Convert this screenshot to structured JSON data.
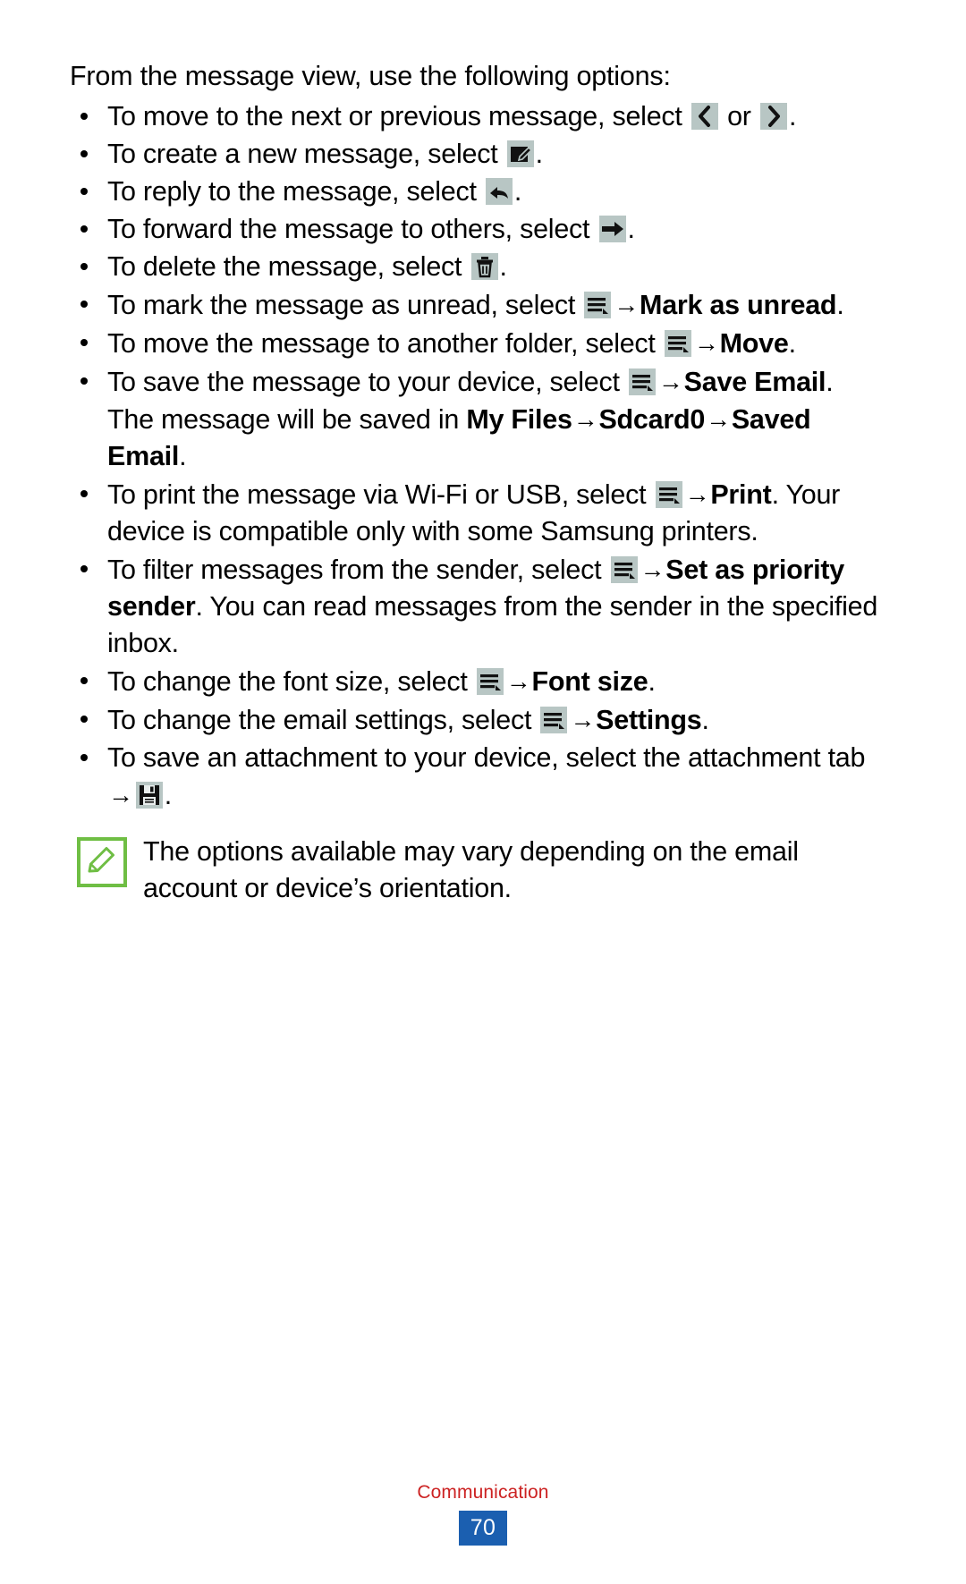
{
  "document": {
    "intro": "From the message view, use the following options:",
    "bullets": [
      {
        "id": "move-next-previous",
        "parts": [
          {
            "t": "text",
            "v": "To move to the next or previous message, select "
          },
          {
            "t": "icon",
            "v": "chevron-left-icon"
          },
          {
            "t": "text",
            "v": " or "
          },
          {
            "t": "icon",
            "v": "chevron-right-icon"
          },
          {
            "t": "text",
            "v": "."
          }
        ]
      },
      {
        "id": "create-new-message",
        "parts": [
          {
            "t": "text",
            "v": "To create a new message, select "
          },
          {
            "t": "icon",
            "v": "compose-icon"
          },
          {
            "t": "text",
            "v": "."
          }
        ]
      },
      {
        "id": "reply-message",
        "parts": [
          {
            "t": "text",
            "v": "To reply to the message, select "
          },
          {
            "t": "icon",
            "v": "reply-arrow-icon"
          },
          {
            "t": "text",
            "v": "."
          }
        ]
      },
      {
        "id": "forward-message",
        "parts": [
          {
            "t": "text",
            "v": "To forward the message to others, select "
          },
          {
            "t": "icon",
            "v": "forward-arrow-icon"
          },
          {
            "t": "text",
            "v": "."
          }
        ]
      },
      {
        "id": "delete-message",
        "parts": [
          {
            "t": "text",
            "v": "To delete the message, select "
          },
          {
            "t": "icon",
            "v": "trash-icon"
          },
          {
            "t": "text",
            "v": "."
          }
        ]
      },
      {
        "id": "mark-as-unread",
        "parts": [
          {
            "t": "text",
            "v": "To mark the message as unread, select "
          },
          {
            "t": "icon",
            "v": "menu-icon"
          },
          {
            "t": "arrow",
            "v": "→"
          },
          {
            "t": "bold",
            "v": "Mark as unread"
          },
          {
            "t": "text",
            "v": "."
          }
        ]
      },
      {
        "id": "move-to-folder",
        "parts": [
          {
            "t": "text",
            "v": "To move the message to another folder, select "
          },
          {
            "t": "icon",
            "v": "menu-icon"
          },
          {
            "t": "arrow",
            "v": "→"
          },
          {
            "t": "bold",
            "v": "Move"
          },
          {
            "t": "text",
            "v": "."
          }
        ]
      },
      {
        "id": "save-email",
        "parts": [
          {
            "t": "text",
            "v": "To save the message to your device, select "
          },
          {
            "t": "icon",
            "v": "menu-icon"
          },
          {
            "t": "arrow",
            "v": "→"
          },
          {
            "t": "bold",
            "v": "Save Email"
          },
          {
            "t": "text",
            "v": ". The message will be saved in "
          },
          {
            "t": "bold",
            "v": "My Files"
          },
          {
            "t": "arrow",
            "v": "→"
          },
          {
            "t": "bold",
            "v": "Sdcard0"
          },
          {
            "t": "arrow",
            "v": "→"
          },
          {
            "t": "bold",
            "v": "Saved Email"
          },
          {
            "t": "text",
            "v": "."
          }
        ]
      },
      {
        "id": "print-message",
        "parts": [
          {
            "t": "text",
            "v": "To print the message via Wi-Fi or USB, select "
          },
          {
            "t": "icon",
            "v": "menu-icon"
          },
          {
            "t": "arrow",
            "v": "→"
          },
          {
            "t": "bold",
            "v": "Print"
          },
          {
            "t": "text",
            "v": ". Your device is compatible only with some Samsung printers."
          }
        ]
      },
      {
        "id": "set-as-priority-sender",
        "parts": [
          {
            "t": "text",
            "v": "To filter messages from the sender, select "
          },
          {
            "t": "icon",
            "v": "menu-icon"
          },
          {
            "t": "arrow",
            "v": "→"
          },
          {
            "t": "bold",
            "v": "Set as priority sender"
          },
          {
            "t": "text",
            "v": ". You can read messages from the sender in the specified inbox."
          }
        ]
      },
      {
        "id": "font-size",
        "parts": [
          {
            "t": "text",
            "v": "To change the font size, select "
          },
          {
            "t": "icon",
            "v": "menu-icon"
          },
          {
            "t": "arrow",
            "v": "→"
          },
          {
            "t": "bold",
            "v": "Font size"
          },
          {
            "t": "text",
            "v": "."
          }
        ]
      },
      {
        "id": "email-settings",
        "parts": [
          {
            "t": "text",
            "v": "To change the email settings, select "
          },
          {
            "t": "icon",
            "v": "menu-icon"
          },
          {
            "t": "arrow",
            "v": "→"
          },
          {
            "t": "bold",
            "v": "Settings"
          },
          {
            "t": "text",
            "v": "."
          }
        ]
      },
      {
        "id": "save-attachment",
        "parts": [
          {
            "t": "text",
            "v": "To save an attachment to your device, select the attachment tab "
          },
          {
            "t": "arrow",
            "v": "→"
          },
          {
            "t": "icon",
            "v": "save-disk-icon"
          },
          {
            "t": "text",
            "v": "."
          }
        ]
      }
    ],
    "note": {
      "icon": "memo-note-icon",
      "text": "The options available may vary depending on the email account or device’s orientation."
    },
    "footer": {
      "section": "Communication",
      "page_number": "70"
    }
  },
  "colors": {
    "icon_chip_background": "#b8c6c4",
    "note_icon_green": "#6fbe44",
    "footer_section_red": "#cc2222",
    "page_number_blue": "#1b5fb0",
    "text_black": "#000000"
  }
}
